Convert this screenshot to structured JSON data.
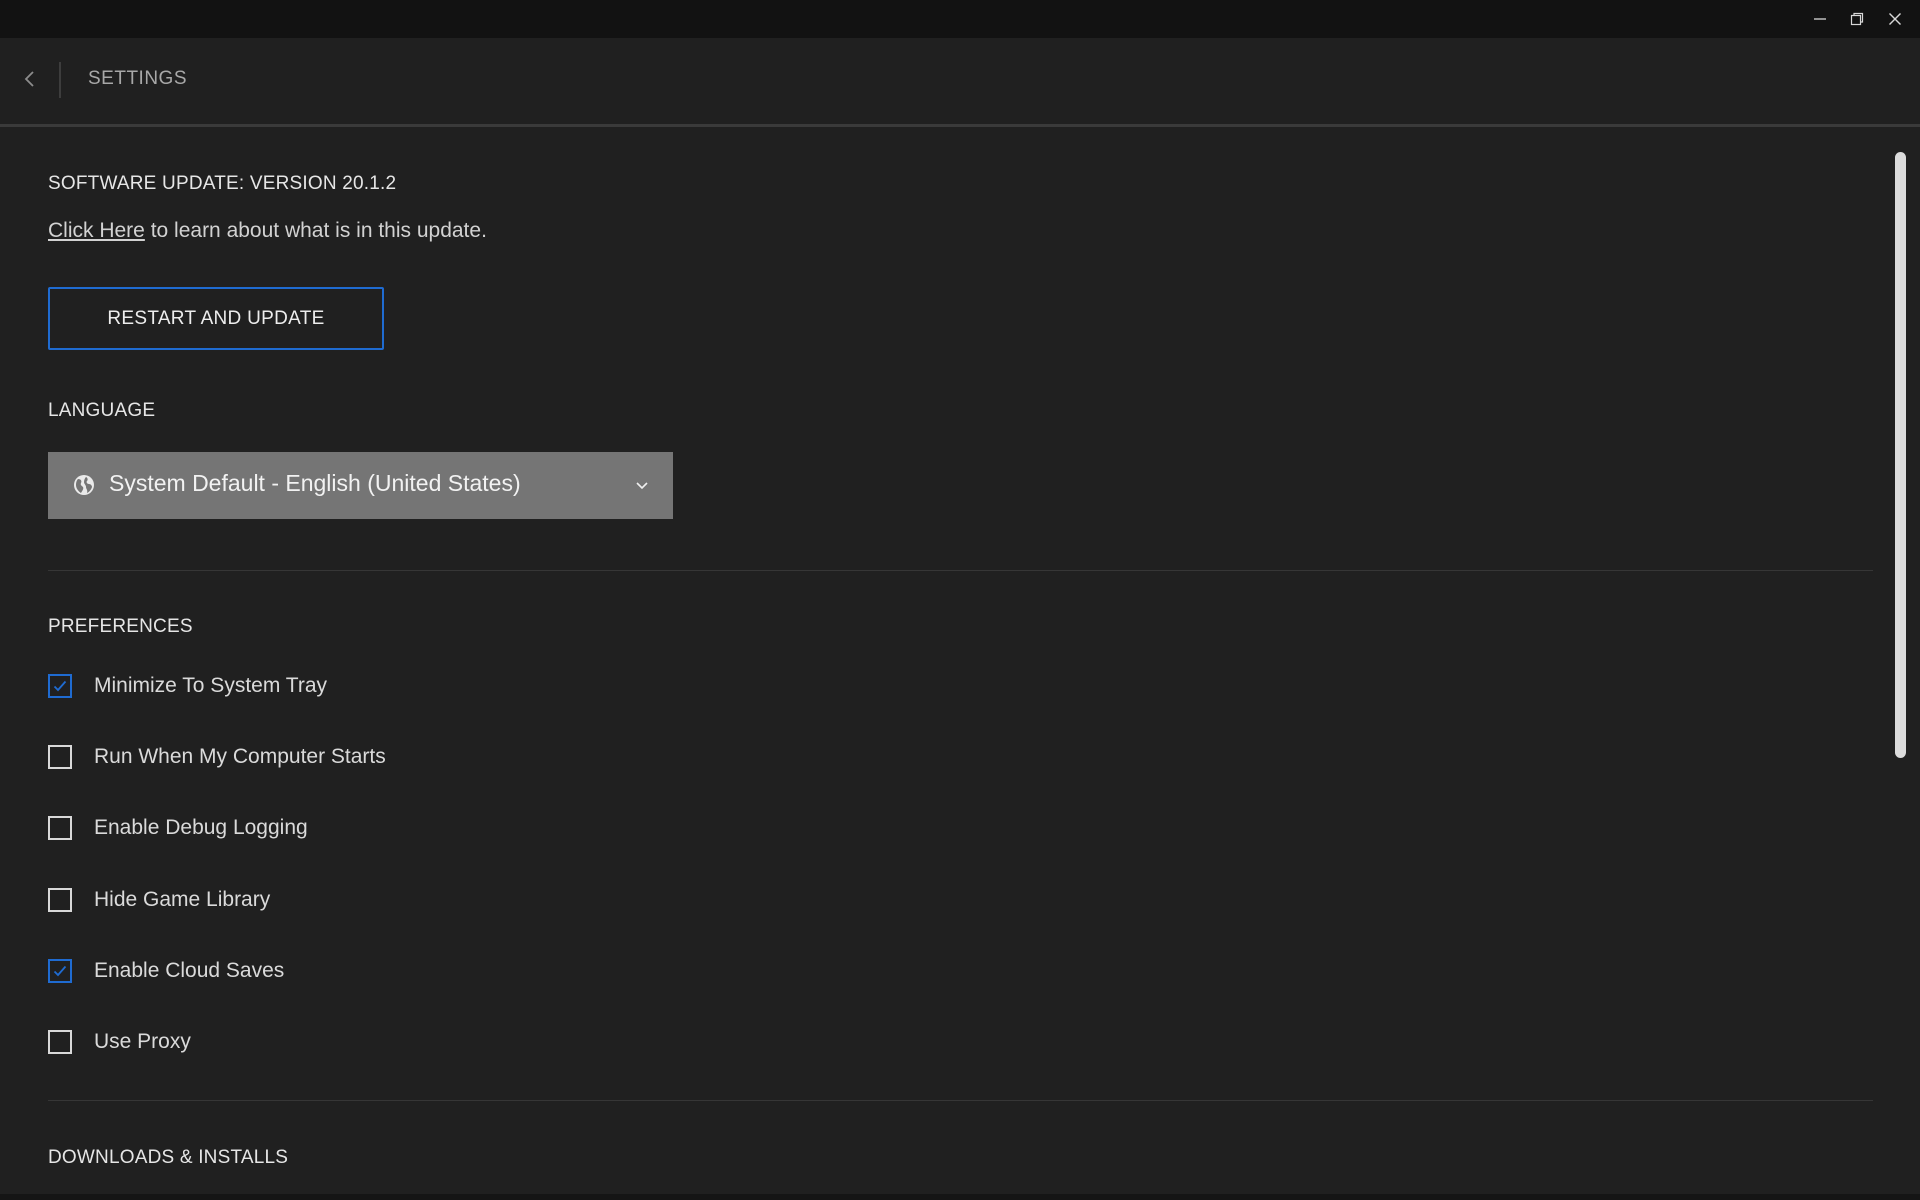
{
  "window": {
    "controls": {
      "minimize_icon": "minimize-icon",
      "maximize_icon": "restore-icon",
      "close_icon": "close-icon"
    }
  },
  "header": {
    "title": "SETTINGS",
    "back_icon": "chevron-left-icon"
  },
  "update": {
    "title": "SOFTWARE UPDATE: VERSION 20.1.2",
    "link_text": "Click Here",
    "line_rest": " to learn about what is in this update.",
    "button_label": "RESTART AND UPDATE"
  },
  "language": {
    "title": "LANGUAGE",
    "selected": "System Default - English (United States)",
    "icon": "globe-icon"
  },
  "preferences": {
    "title": "PREFERENCES",
    "items": [
      {
        "label": "Minimize To System Tray",
        "checked": true
      },
      {
        "label": "Run When My Computer Starts",
        "checked": false
      },
      {
        "label": "Enable Debug Logging",
        "checked": false
      },
      {
        "label": "Hide Game Library",
        "checked": false
      },
      {
        "label": "Enable Cloud Saves",
        "checked": true
      },
      {
        "label": "Use Proxy",
        "checked": false
      }
    ]
  },
  "downloads": {
    "title": "DOWNLOADS & INSTALLS"
  },
  "colors": {
    "accent": "#1f6bd1",
    "background": "#202020",
    "titlebar": "#121212",
    "dropdown": "#757575"
  }
}
